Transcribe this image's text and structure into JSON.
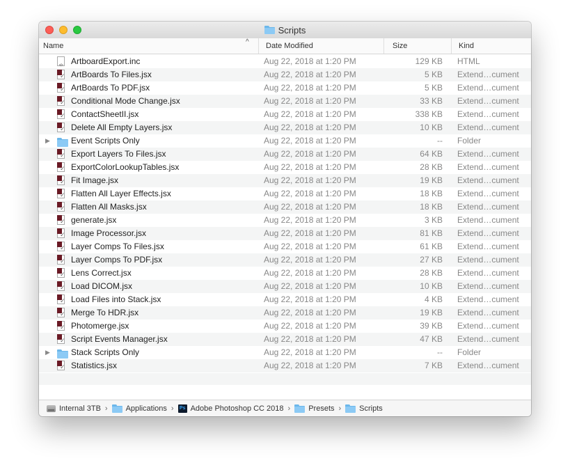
{
  "window": {
    "title": "Scripts"
  },
  "columns": {
    "name": "Name",
    "date": "Date Modified",
    "size": "Size",
    "kind": "Kind"
  },
  "rows": [
    {
      "type": "html",
      "name": "ArtboardExport.inc",
      "date": "Aug 22, 2018 at 1:20 PM",
      "size": "129 KB",
      "kind": "HTML",
      "disclosure": ""
    },
    {
      "type": "jsx",
      "name": "ArtBoards To Files.jsx",
      "date": "Aug 22, 2018 at 1:20 PM",
      "size": "5 KB",
      "kind": "Extend…cument",
      "disclosure": ""
    },
    {
      "type": "jsx",
      "name": "ArtBoards To PDF.jsx",
      "date": "Aug 22, 2018 at 1:20 PM",
      "size": "5 KB",
      "kind": "Extend…cument",
      "disclosure": ""
    },
    {
      "type": "jsx",
      "name": "Conditional Mode Change.jsx",
      "date": "Aug 22, 2018 at 1:20 PM",
      "size": "33 KB",
      "kind": "Extend…cument",
      "disclosure": ""
    },
    {
      "type": "jsx",
      "name": "ContactSheetII.jsx",
      "date": "Aug 22, 2018 at 1:20 PM",
      "size": "338 KB",
      "kind": "Extend…cument",
      "disclosure": ""
    },
    {
      "type": "jsx",
      "name": "Delete All Empty Layers.jsx",
      "date": "Aug 22, 2018 at 1:20 PM",
      "size": "10 KB",
      "kind": "Extend…cument",
      "disclosure": ""
    },
    {
      "type": "folder",
      "name": "Event Scripts Only",
      "date": "Aug 22, 2018 at 1:20 PM",
      "size": "--",
      "kind": "Folder",
      "disclosure": "▶"
    },
    {
      "type": "jsx",
      "name": "Export Layers To Files.jsx",
      "date": "Aug 22, 2018 at 1:20 PM",
      "size": "64 KB",
      "kind": "Extend…cument",
      "disclosure": ""
    },
    {
      "type": "jsx",
      "name": "ExportColorLookupTables.jsx",
      "date": "Aug 22, 2018 at 1:20 PM",
      "size": "28 KB",
      "kind": "Extend…cument",
      "disclosure": ""
    },
    {
      "type": "jsx",
      "name": "Fit Image.jsx",
      "date": "Aug 22, 2018 at 1:20 PM",
      "size": "19 KB",
      "kind": "Extend…cument",
      "disclosure": ""
    },
    {
      "type": "jsx",
      "name": "Flatten All Layer Effects.jsx",
      "date": "Aug 22, 2018 at 1:20 PM",
      "size": "18 KB",
      "kind": "Extend…cument",
      "disclosure": ""
    },
    {
      "type": "jsx",
      "name": "Flatten All Masks.jsx",
      "date": "Aug 22, 2018 at 1:20 PM",
      "size": "18 KB",
      "kind": "Extend…cument",
      "disclosure": ""
    },
    {
      "type": "jsx",
      "name": "generate.jsx",
      "date": "Aug 22, 2018 at 1:20 PM",
      "size": "3 KB",
      "kind": "Extend…cument",
      "disclosure": ""
    },
    {
      "type": "jsx",
      "name": "Image Processor.jsx",
      "date": "Aug 22, 2018 at 1:20 PM",
      "size": "81 KB",
      "kind": "Extend…cument",
      "disclosure": ""
    },
    {
      "type": "jsx",
      "name": "Layer Comps To Files.jsx",
      "date": "Aug 22, 2018 at 1:20 PM",
      "size": "61 KB",
      "kind": "Extend…cument",
      "disclosure": ""
    },
    {
      "type": "jsx",
      "name": "Layer Comps To PDF.jsx",
      "date": "Aug 22, 2018 at 1:20 PM",
      "size": "27 KB",
      "kind": "Extend…cument",
      "disclosure": ""
    },
    {
      "type": "jsx",
      "name": "Lens Correct.jsx",
      "date": "Aug 22, 2018 at 1:20 PM",
      "size": "28 KB",
      "kind": "Extend…cument",
      "disclosure": ""
    },
    {
      "type": "jsx",
      "name": "Load DICOM.jsx",
      "date": "Aug 22, 2018 at 1:20 PM",
      "size": "10 KB",
      "kind": "Extend…cument",
      "disclosure": ""
    },
    {
      "type": "jsx",
      "name": "Load Files into Stack.jsx",
      "date": "Aug 22, 2018 at 1:20 PM",
      "size": "4 KB",
      "kind": "Extend…cument",
      "disclosure": ""
    },
    {
      "type": "jsx",
      "name": "Merge To HDR.jsx",
      "date": "Aug 22, 2018 at 1:20 PM",
      "size": "19 KB",
      "kind": "Extend…cument",
      "disclosure": ""
    },
    {
      "type": "jsx",
      "name": "Photomerge.jsx",
      "date": "Aug 22, 2018 at 1:20 PM",
      "size": "39 KB",
      "kind": "Extend…cument",
      "disclosure": ""
    },
    {
      "type": "jsx",
      "name": "Script Events Manager.jsx",
      "date": "Aug 22, 2018 at 1:20 PM",
      "size": "47 KB",
      "kind": "Extend…cument",
      "disclosure": ""
    },
    {
      "type": "folder",
      "name": "Stack Scripts Only",
      "date": "Aug 22, 2018 at 1:20 PM",
      "size": "--",
      "kind": "Folder",
      "disclosure": "▶"
    },
    {
      "type": "jsx",
      "name": "Statistics.jsx",
      "date": "Aug 22, 2018 at 1:20 PM",
      "size": "7 KB",
      "kind": "Extend…cument",
      "disclosure": ""
    }
  ],
  "pathbar": [
    {
      "label": "Internal 3TB",
      "icon": "disk"
    },
    {
      "label": "Applications",
      "icon": "folder"
    },
    {
      "label": "Adobe Photoshop CC 2018",
      "icon": "ps"
    },
    {
      "label": "Presets",
      "icon": "folder"
    },
    {
      "label": "Scripts",
      "icon": "folder"
    }
  ],
  "pathbar_separator": "›",
  "sort_indicator": "^",
  "colors": {
    "close": "#fc5e57",
    "minimize": "#fdbc2e",
    "zoom": "#29c841",
    "folder": "#8ccaf5",
    "jsx_badge": "#6a1a25"
  }
}
